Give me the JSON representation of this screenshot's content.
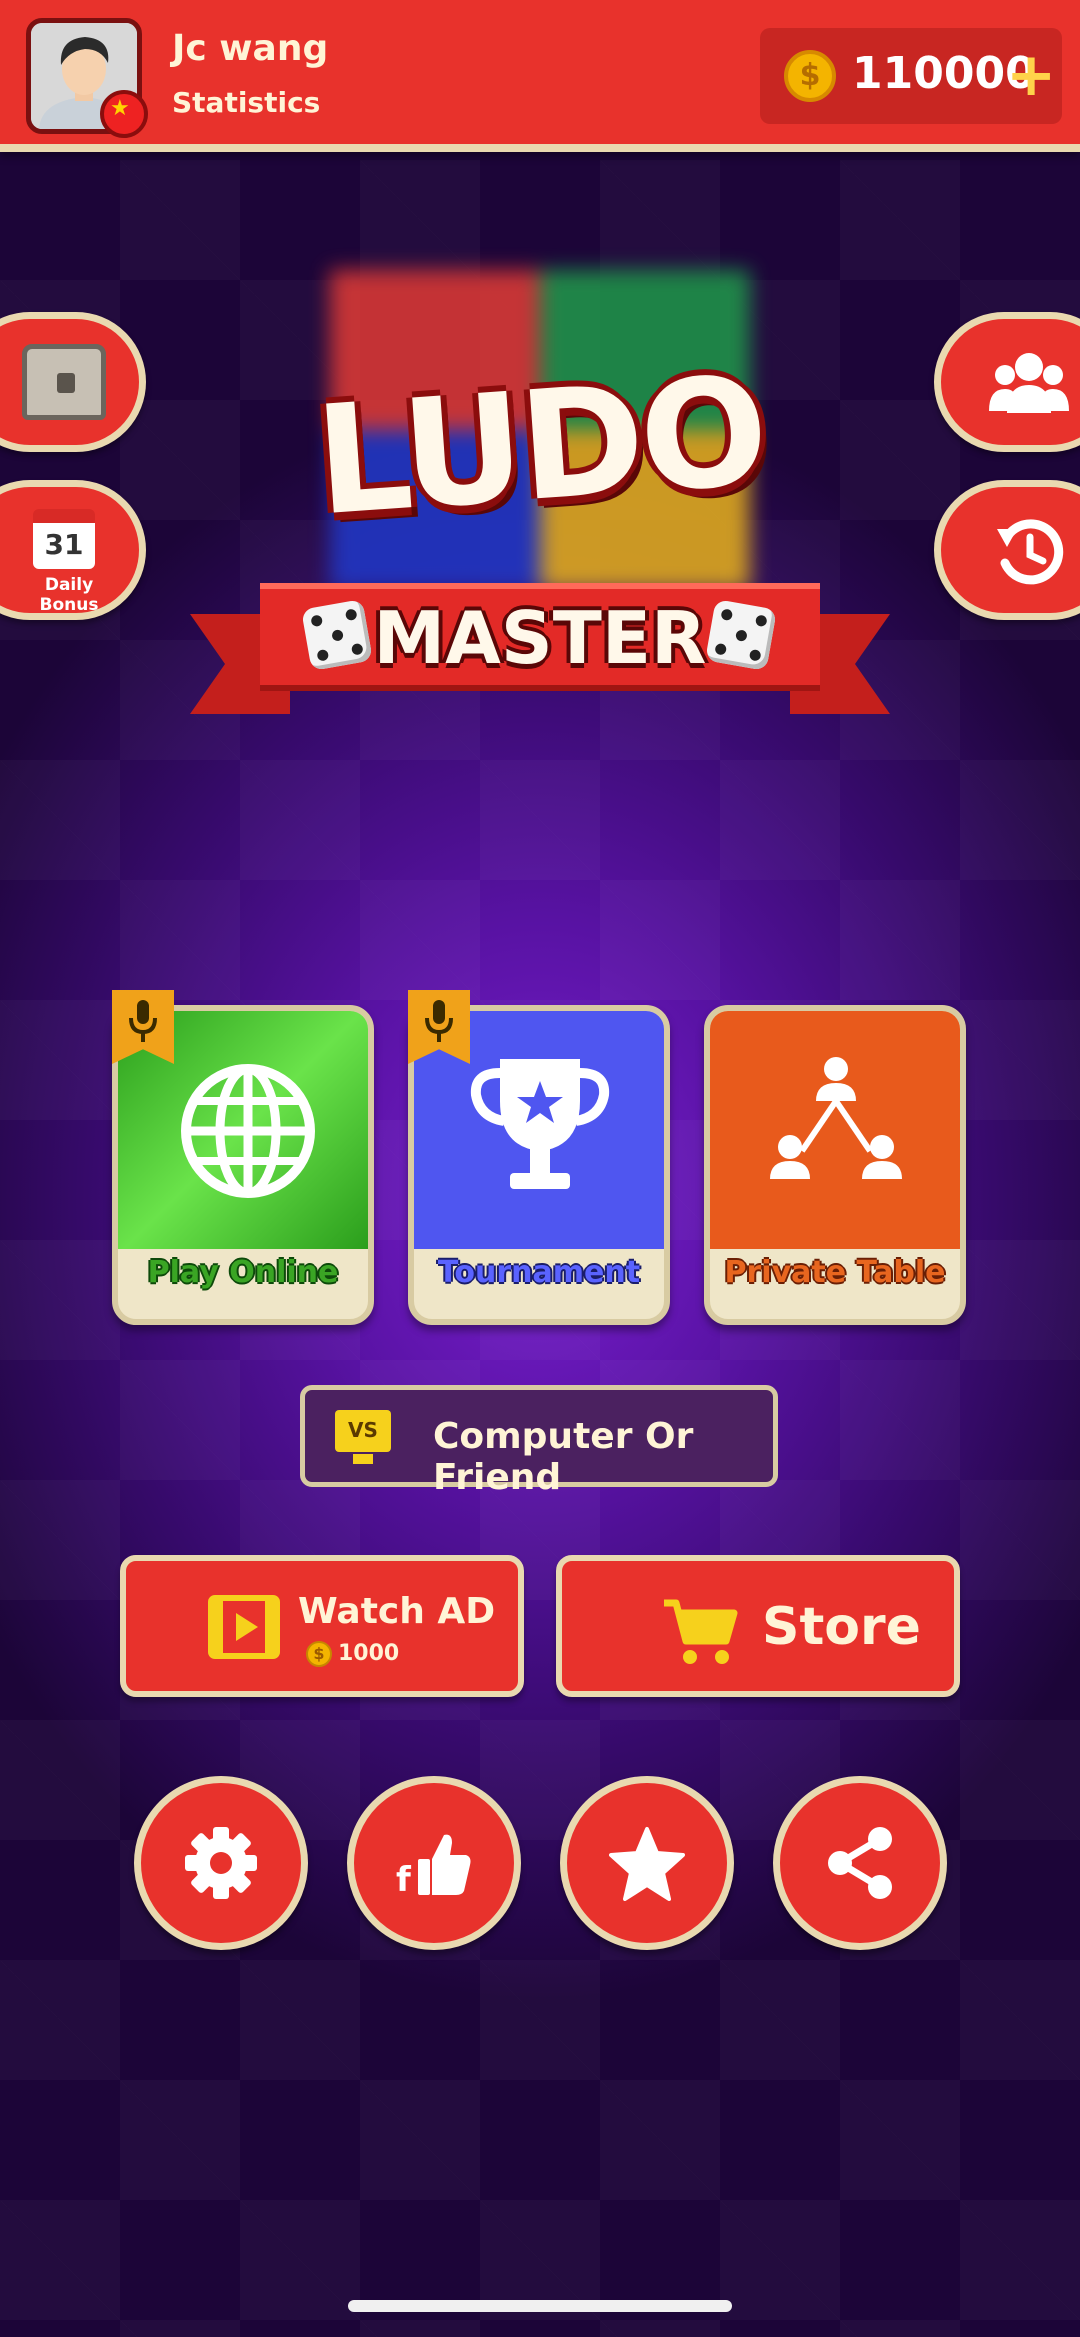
{
  "header": {
    "user_name": "Jc wang",
    "stats_link": "Statistics",
    "coin_balance": "110000",
    "coin_symbol": "$",
    "plus_symbol": "+"
  },
  "side_left": {
    "daily_bonus_day": "31",
    "daily_bonus_label": "Daily Bonus"
  },
  "logo": {
    "line1": "LUDO",
    "line2": "MASTER"
  },
  "modes": [
    {
      "label": "Play Online",
      "color": "#2fae1f"
    },
    {
      "label": "Tournament",
      "color": "#4f56f0"
    },
    {
      "label": "Private Table",
      "color": "#e85a1c"
    }
  ],
  "computer_friend": {
    "vs": "VS",
    "label": "Computer Or Friend"
  },
  "watch_ad": {
    "label": "Watch AD",
    "reward": "1000",
    "coin_symbol": "$"
  },
  "store": {
    "label": "Store"
  },
  "colors": {
    "primary_red": "#e8322c",
    "cream_border": "#e9d9b0",
    "coin_gold": "#f4b400",
    "background_purple": "#5812a3"
  }
}
